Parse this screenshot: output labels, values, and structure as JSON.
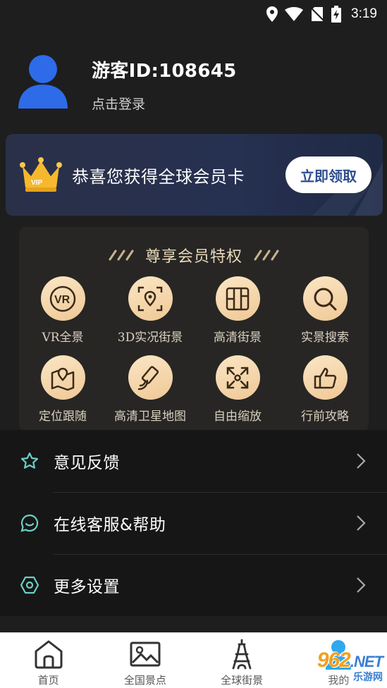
{
  "status_bar": {
    "time": "3:19"
  },
  "profile": {
    "user_id": "游客ID:108645",
    "login_text": "点击登录"
  },
  "vip_banner": {
    "title": "恭喜您获得全球会员卡",
    "claim_label": "立即领取",
    "badge": "VIP"
  },
  "privileges": {
    "title": "尊享会员特权",
    "items": [
      {
        "label": "VR全景",
        "icon": "vr-icon"
      },
      {
        "label": "3D实况街景",
        "icon": "location-scan-icon"
      },
      {
        "label": "高清街景",
        "icon": "buildings-icon"
      },
      {
        "label": "实景搜索",
        "icon": "search-icon"
      },
      {
        "label": "定位跟随",
        "icon": "map-pin-icon"
      },
      {
        "label": "高清卫星地图",
        "icon": "satellite-icon"
      },
      {
        "label": "自由缩放",
        "icon": "zoom-icon"
      },
      {
        "label": "行前攻略",
        "icon": "thumbs-up-icon"
      }
    ]
  },
  "menu": {
    "items": [
      {
        "label": "意见反馈",
        "icon": "star-icon"
      },
      {
        "label": "在线客服&帮助",
        "icon": "chat-icon"
      },
      {
        "label": "更多设置",
        "icon": "settings-icon"
      }
    ]
  },
  "tab_bar": {
    "tabs": [
      {
        "label": "首页",
        "icon": "home-icon"
      },
      {
        "label": "全国景点",
        "icon": "picture-icon"
      },
      {
        "label": "全球街景",
        "icon": "tower-icon"
      },
      {
        "label": "我的",
        "icon": "person-icon"
      }
    ]
  },
  "watermark": {
    "main": "962",
    "suffix": ".NET",
    "sub": "乐游网"
  },
  "colors": {
    "accent_gold": "#efc896",
    "banner": "#263050",
    "claim_text": "#2f4f8f",
    "avatar_blue": "#2d6be8",
    "menu_icon_teal": "#6ecfc4"
  }
}
